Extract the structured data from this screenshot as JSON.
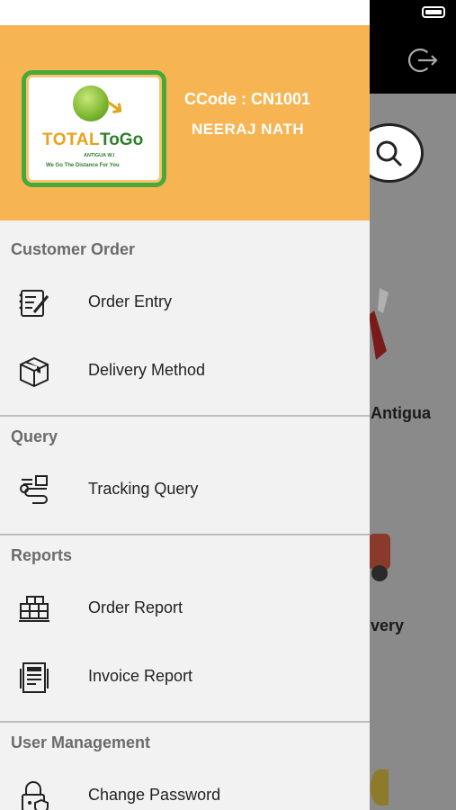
{
  "header": {
    "logo": {
      "brand_total": "TOTAL",
      "brand_togo": "ToGo",
      "location": "ANTIGUA W.I",
      "tagline": "We Go The Distance For You"
    },
    "ccode": "CCode : CN1001",
    "user_name": "NEERAJ NATH"
  },
  "menu": {
    "sections": [
      {
        "title": "Customer Order",
        "items": [
          {
            "label": "Order Entry",
            "icon": "order-entry-icon"
          },
          {
            "label": "Delivery Method",
            "icon": "box-icon"
          }
        ]
      },
      {
        "title": "Query",
        "items": [
          {
            "label": "Tracking Query",
            "icon": "tracking-icon"
          }
        ]
      },
      {
        "title": "Reports",
        "items": [
          {
            "label": "Order Report",
            "icon": "boxes-report-icon"
          },
          {
            "label": "Invoice Report",
            "icon": "invoice-icon"
          }
        ]
      },
      {
        "title": "User Management",
        "items": [
          {
            "label": "Change Password",
            "icon": "lock-icon"
          }
        ]
      }
    ]
  },
  "background": {
    "label1": "Antigua",
    "label2": "very"
  },
  "colors": {
    "header_bg": "#f6b552",
    "drawer_bg": "#f2f2f2",
    "section_title": "#6b6b6b"
  }
}
